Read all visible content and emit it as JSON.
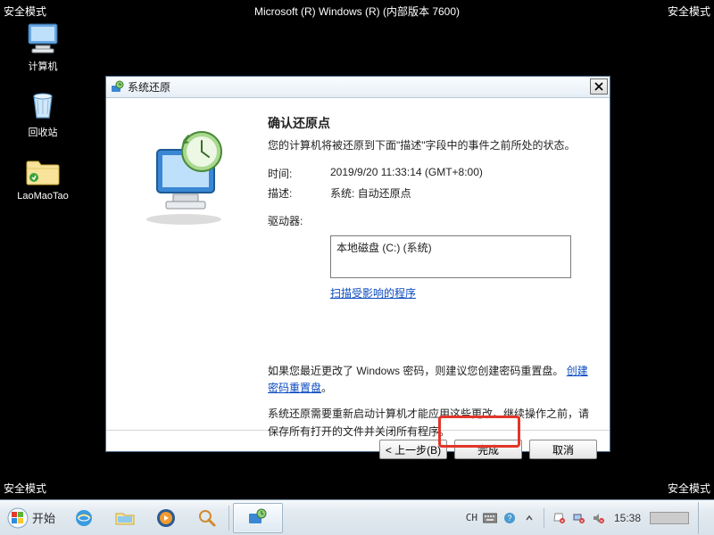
{
  "safe_mode_label": "安全模式",
  "os_header": "Microsoft (R) Windows (R) (内部版本 7600)",
  "desktop": {
    "computer": "计算机",
    "recycle": "回收站",
    "laomaotao": "LaoMaoTao"
  },
  "dialog": {
    "title": "系统还原",
    "heading": "确认还原点",
    "subtitle": "您的计算机将被还原到下面\"描述\"字段中的事件之前所处的状态。",
    "time_label": "时间:",
    "time_value": "2019/9/20 11:33:14 (GMT+8:00)",
    "desc_label": "描述:",
    "desc_value": "系统: 自动还原点",
    "drives_label": "驱动器:",
    "drives_value": "本地磁盘 (C:) (系统)",
    "scan_link": "扫描受影响的程序",
    "advice1_pre": "如果您最近更改了 Windows 密码，则建议您创建密码重置盘。",
    "advice1_link": "创建密码重置盘",
    "advice1_post": "。",
    "advice2": "系统还原需要重新启动计算机才能应用这些更改。继续操作之前，请保存所有打开的文件并关闭所有程序。",
    "back_btn": "< 上一步(B)",
    "finish_btn": "完成",
    "cancel_btn": "取消"
  },
  "taskbar": {
    "start": "开始",
    "ime": "CH",
    "clock": "15:38"
  }
}
